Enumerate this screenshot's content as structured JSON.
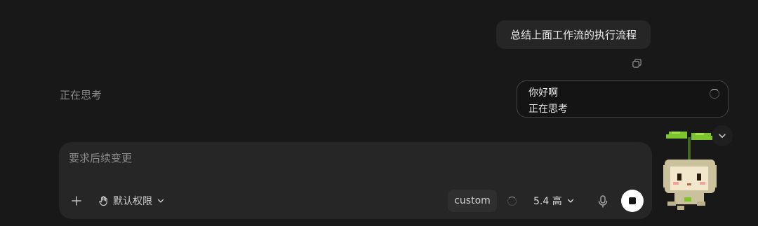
{
  "conversation": {
    "user_message": "总结上面工作流的执行流程",
    "thinking_label": "正在思考"
  },
  "status_card": {
    "title": "你好啊",
    "subtitle": "正在思考"
  },
  "composer": {
    "placeholder": "要求后续变更",
    "permission_label": "默认权限",
    "custom_label": "custom",
    "model_label": "5.4 高"
  },
  "colors": {
    "background": "#181818",
    "bubble": "#262626",
    "composer": "#262626",
    "stop_button": "#ffffff"
  },
  "icons": [
    "copy-icon",
    "spinner-icon",
    "chevron-down-icon",
    "plus-icon",
    "hand-icon",
    "microphone-icon",
    "stop-icon"
  ]
}
